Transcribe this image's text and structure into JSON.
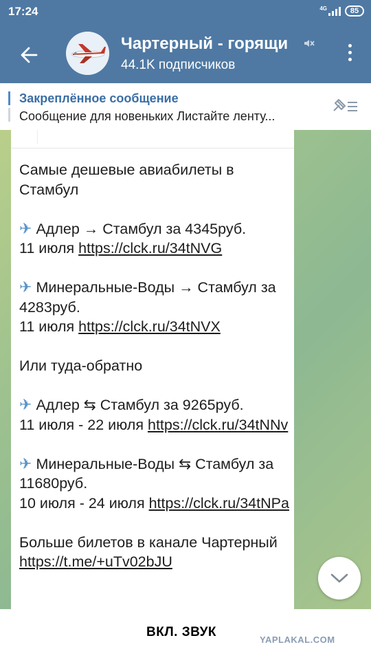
{
  "status_bar": {
    "time": "17:24",
    "network": "4G",
    "battery": "85"
  },
  "header": {
    "title": "Чартерный - горящи",
    "subscribers": "44.1K подписчиков"
  },
  "pinned": {
    "title": "Закреплённое сообщение",
    "text": "Сообщение для новеньких  Листайте ленту..."
  },
  "message": {
    "intro": "Самые дешевые авиабилеты в Стамбул",
    "offers": [
      {
        "icon": "airplane-icon",
        "route": "Адлер → Стамбул за 4345руб.",
        "date": "11 июля",
        "link": "https://clck.ru/34tNVG"
      },
      {
        "icon": "airplane-icon",
        "route": "Минеральные-Воды → Стамбул за 4283руб.",
        "date": "11 июля",
        "link": "https://clck.ru/34tNVX"
      }
    ],
    "roundtrip_heading": "Или туда-обратно",
    "roundtrips": [
      {
        "icon": "airplane-icon",
        "route": "Адлер ⇆ Стамбул за 9265руб.",
        "date": "11 июля - 22 июля",
        "link": "https://clck.ru/34tNNv"
      },
      {
        "icon": "airplane-icon",
        "route": "Минеральные-Воды ⇆ Стамбул за 11680руб.",
        "date": "10 июля - 24 июля",
        "link": "https://clck.ru/34tNPa"
      }
    ],
    "more_text": "Больше билетов в канале Чартерный",
    "more_link": "https://t.me/+uTv02bJU"
  },
  "bottom": {
    "unmute_label": "ВКЛ. ЗВУК",
    "watermark": "YAPLAKAL.COM"
  },
  "colors": {
    "header_bg": "#4f79a3",
    "pinned_title": "#3a6ea5"
  }
}
